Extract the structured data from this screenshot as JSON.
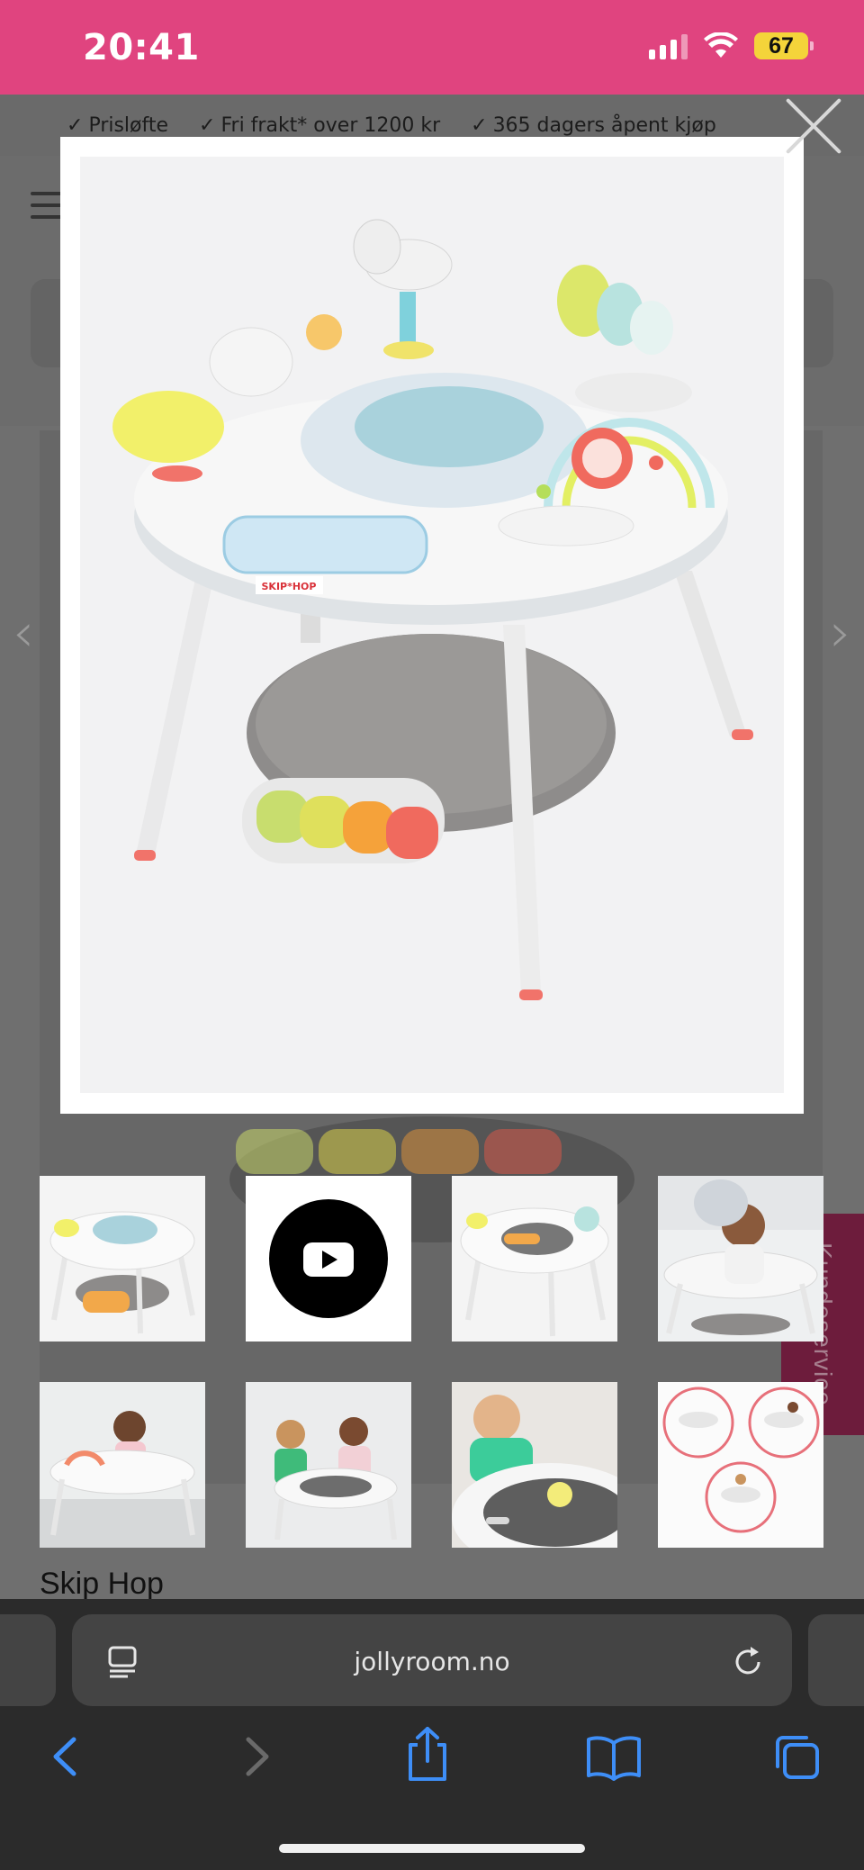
{
  "status_bar": {
    "time": "20:41",
    "battery_level": "67",
    "icons": [
      "cellular-signal-icon",
      "wifi-icon",
      "battery-icon"
    ]
  },
  "usp_bar": {
    "items": [
      "Prisløfte",
      "Fri frakt* over 1200 kr",
      "365 dagers åpent kjøp"
    ]
  },
  "product": {
    "brand": "Skip Hop"
  },
  "modal": {
    "image_alt": "Skip Hop activity center",
    "close_icon": "close-icon"
  },
  "thumbnails": [
    {
      "kind": "product-photo"
    },
    {
      "kind": "video",
      "icon": "youtube-play-icon"
    },
    {
      "kind": "product-photo-top"
    },
    {
      "kind": "baby-in-seat"
    },
    {
      "kind": "toddler-at-table"
    },
    {
      "kind": "two-kids-at-table"
    },
    {
      "kind": "child-drawing"
    },
    {
      "kind": "three-stages-diagram"
    }
  ],
  "side_tab": {
    "label": "Kundeservice"
  },
  "browser": {
    "url": "jollyroom.no",
    "toolbar_icons": [
      "back-icon",
      "forward-icon",
      "share-icon",
      "bookmarks-icon",
      "tabs-icon"
    ]
  },
  "colors": {
    "status_bar": "#e0447f",
    "battery": "#f4d43a",
    "safari_accent": "#3e8ef7",
    "kundeservice": "#6d1c3c"
  }
}
